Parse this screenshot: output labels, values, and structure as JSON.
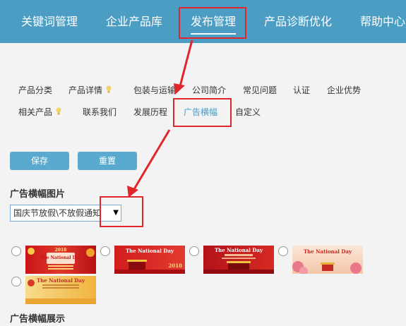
{
  "nav": {
    "items": [
      {
        "label": "关键词管理"
      },
      {
        "label": "企业产品库"
      },
      {
        "label": "发布管理",
        "active": true
      },
      {
        "label": "产品诊断优化"
      },
      {
        "label": "帮助中心"
      }
    ]
  },
  "subtabs": [
    {
      "label": "产品分类"
    },
    {
      "label": "产品详情"
    },
    {
      "label": "包装与运输"
    },
    {
      "label": "公司简介"
    },
    {
      "label": "常见问题"
    },
    {
      "label": "认证"
    },
    {
      "label": "企业优势"
    },
    {
      "label": "相关产品"
    },
    {
      "label": "联系我们"
    },
    {
      "label": "发展历程"
    },
    {
      "label": "广告横幅",
      "active": true
    },
    {
      "label": "自定义"
    }
  ],
  "buttons": {
    "save": "保存",
    "reset": "重置"
  },
  "banner_section": {
    "title": "广告横幅图片",
    "select_value": "国庆节放假\\不放假通知"
  },
  "banners": [
    {
      "title": "The National Day",
      "year": "2018"
    },
    {
      "title": "The National Day",
      "year": "2018"
    },
    {
      "title": "The National Day"
    },
    {
      "title": "The National Day"
    },
    {
      "title": "The National Day"
    }
  ],
  "display_section": {
    "title": "广告横幅展示"
  },
  "colors": {
    "nav_bg": "#4c9dc4",
    "accent": "#4c9dc4",
    "button": "#5aa9cf",
    "highlight": "#e0262c"
  }
}
